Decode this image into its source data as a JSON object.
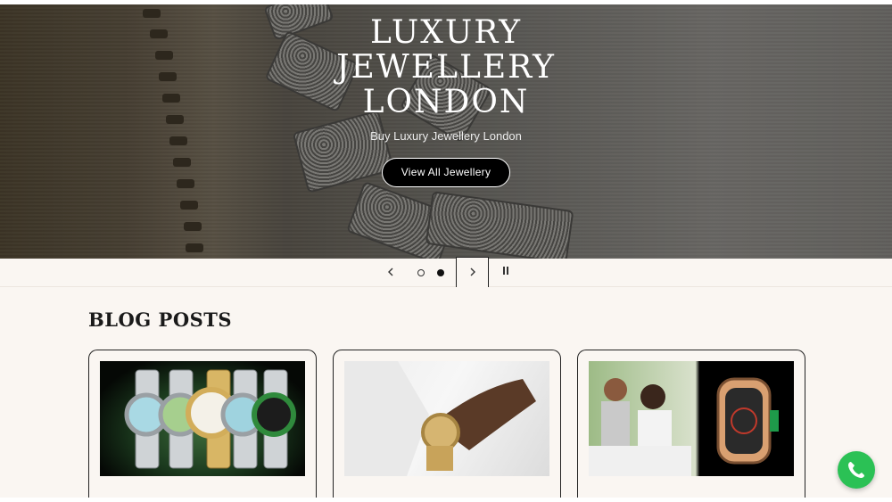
{
  "hero": {
    "title": "LUXURY JEWELLERY LONDON",
    "subtitle": "Buy Luxury Jewellery London",
    "cta_label": "View All Jewellery"
  },
  "slider": {
    "prev_icon": "chevron-left-icon",
    "next_icon": "chevron-right-icon",
    "pause_icon": "pause-icon",
    "slide_count": 2,
    "active_slide": 2
  },
  "blog": {
    "heading": "BLOG POSTS",
    "posts": [
      {
        "image": "rolex-watches-lineup"
      },
      {
        "image": "gold-watch-on-wrist"
      },
      {
        "image": "celebrities-and-richard-mille-watch"
      }
    ]
  },
  "whatsapp": {
    "icon": "phone-icon",
    "color": "#2bc155"
  }
}
